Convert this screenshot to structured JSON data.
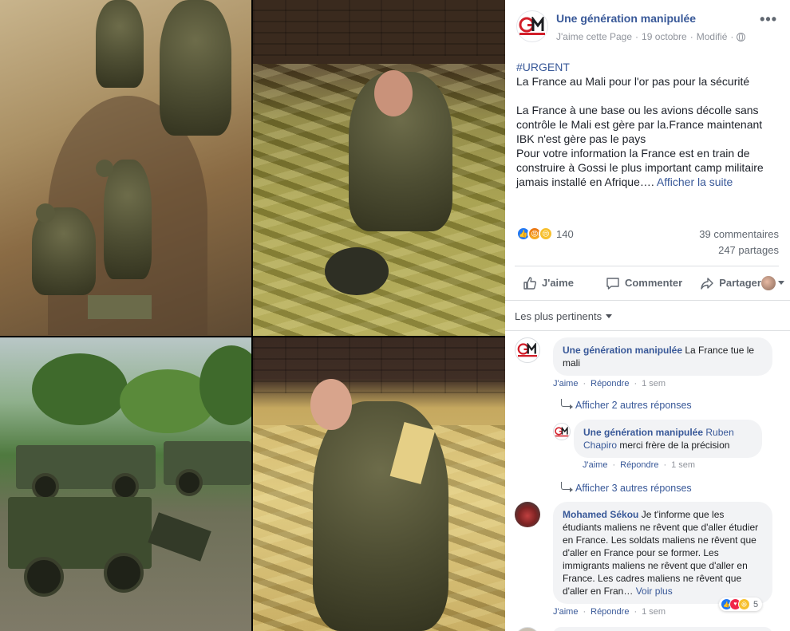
{
  "post": {
    "page_name": "Une génération manipulée",
    "like_page": "J'aime cette Page",
    "date": "19 octobre",
    "edited": "Modifié",
    "more": "•••",
    "hashtag": "#URGENT",
    "line1": "La France au Mali pour l'or pas pour la sécurité",
    "para2": "La France à une base ou les avions décolle sans contrôle le Mali est gère par la.France maintenant IBK n'est gère pas le pays",
    "para3": "Pour votre information la France est en train de construire à Gossi le plus important camp militaire jamais installé en Afrique….",
    "see_more": "Afficher la suite"
  },
  "stats": {
    "reactions_count": "140",
    "comments": "39 commentaires",
    "shares": "247 partages"
  },
  "actions": {
    "like": "J'aime",
    "comment": "Commenter",
    "share": "Partager"
  },
  "comments": {
    "sort_label": "Les plus pertinents",
    "like_label": "J'aime",
    "reply_label": "Répondre",
    "time_1sem": "1 sem",
    "c1": {
      "author": "Une génération manipulée",
      "text": "La France tue le mali"
    },
    "c1_replies_link": "Afficher 2 autres réponses",
    "r1": {
      "author": "Une génération manipulée",
      "tag": "Ruben Chapiro",
      "text": "merci frère de la précision"
    },
    "r1_replies_link": "Afficher 3 autres réponses",
    "c2": {
      "author": "Mohamed Sékou",
      "text": "Je t'informe que les étudiants maliens ne rêvent que d'aller étudier en France. Les soldats maliens ne rêvent que d'aller en France pour se former. Les immigrants maliens ne rêvent que d'aller en France. Les cadres maliens ne rêvent que d'aller en Fran…",
      "see_more": "Voir plus",
      "reaction_count": "5"
    }
  },
  "colors": {
    "link_blue": "#385898",
    "like_blue": "#2078f4",
    "gray_text": "#606770",
    "bubble_bg": "#f2f3f5"
  }
}
